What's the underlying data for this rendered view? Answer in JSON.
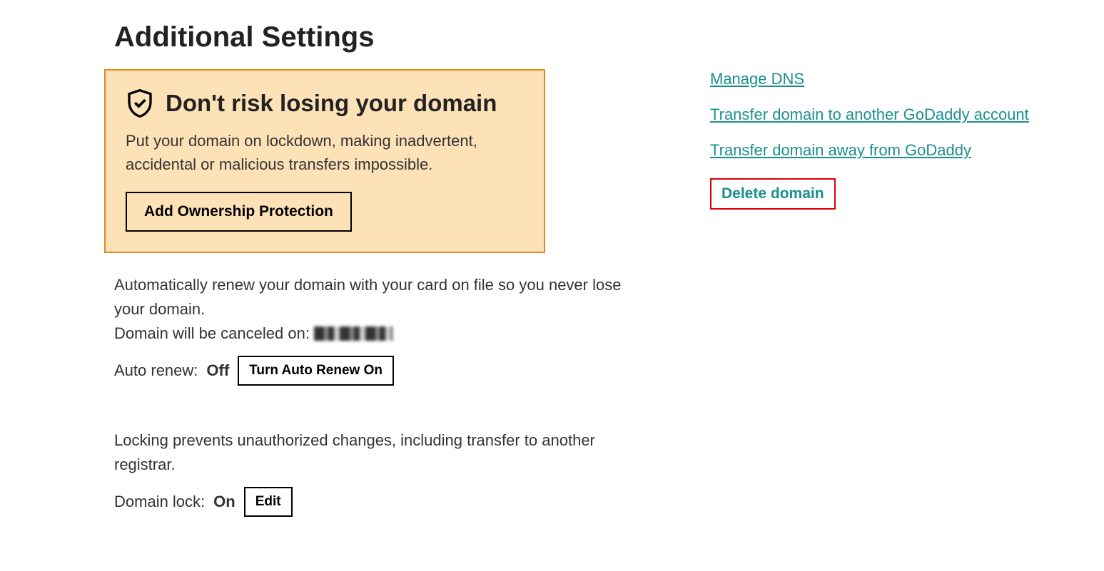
{
  "page": {
    "title": "Additional Settings"
  },
  "ownership": {
    "heading": "Don't risk losing your domain",
    "description": "Put your domain on lockdown, making inadvertent, accidental or malicious transfers impossible.",
    "button_label": "Add Ownership Protection"
  },
  "auto_renew": {
    "description": "Automatically renew your domain with your card on file so you never lose your domain.",
    "cancel_prefix": "Domain will be canceled on:",
    "label": "Auto renew:",
    "status": "Off",
    "toggle_button": "Turn Auto Renew On"
  },
  "domain_lock": {
    "description": "Locking prevents unauthorized changes, including transfer to another registrar.",
    "label": "Domain lock:",
    "status": "On",
    "edit_button": "Edit"
  },
  "side_links": {
    "manage_dns": "Manage DNS",
    "transfer_another": "Transfer domain to another GoDaddy account",
    "transfer_away": "Transfer domain away from GoDaddy",
    "delete": "Delete domain"
  }
}
